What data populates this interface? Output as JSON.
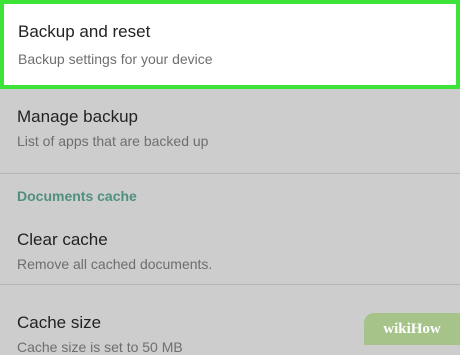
{
  "settings": {
    "items": [
      {
        "title": "Backup and reset",
        "subtitle": "Backup settings for your device"
      },
      {
        "title": "Manage backup",
        "subtitle": "List of apps that are backed up"
      },
      {
        "title": "Clear cache",
        "subtitle": "Remove all cached documents."
      },
      {
        "title": "Cache size",
        "subtitle": "Cache size is set to 50 MB"
      }
    ],
    "section_header": "Documents cache"
  },
  "watermark": {
    "part1": "wiki",
    "part2": "How"
  },
  "colors": {
    "highlight_border": "#3ee33a",
    "section_header": "#4f8f7f",
    "background": "#cdcdcd"
  }
}
